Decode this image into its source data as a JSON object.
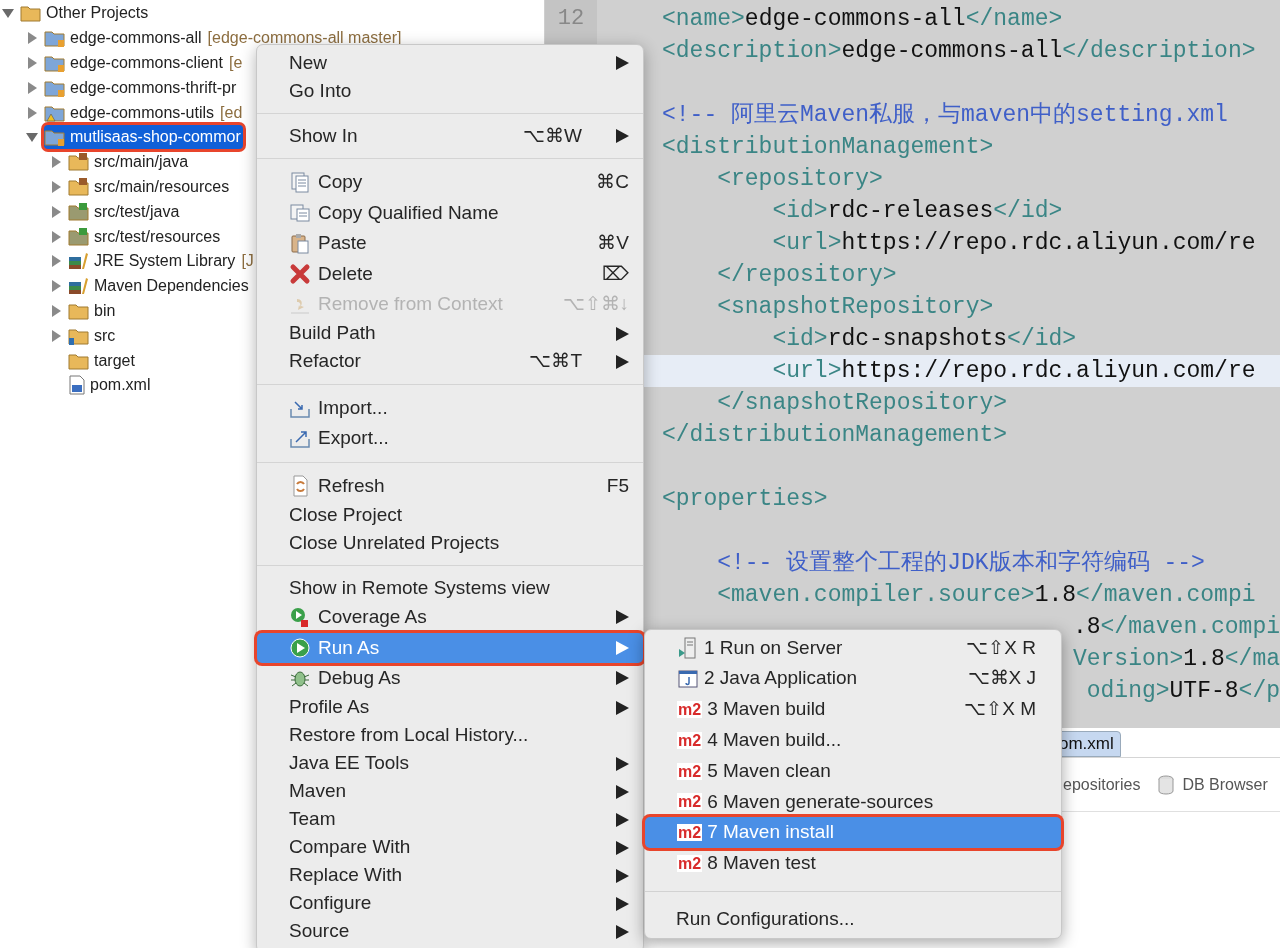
{
  "project_tree": {
    "items": [
      {
        "label": "Other Projects",
        "kind": "working-set",
        "expandable": true,
        "expanded": true,
        "selected": false,
        "children": [
          {
            "label": "edge-commons-all",
            "decoration": "[edge-commons-all master]",
            "kind": "project",
            "expandable": true,
            "expanded": false,
            "selected": false
          },
          {
            "label": "edge-commons-client",
            "decoration": "[e",
            "kind": "project",
            "expandable": true,
            "expanded": false,
            "selected": false
          },
          {
            "label": "edge-commons-thrift-pr",
            "kind": "project",
            "expandable": true,
            "expanded": false,
            "selected": false
          },
          {
            "label": "edge-commons-utils",
            "decoration": "[ed",
            "kind": "project-warning",
            "expandable": true,
            "expanded": false,
            "selected": false
          },
          {
            "label": "mutlisaas-shop-commor",
            "kind": "project",
            "expandable": true,
            "expanded": true,
            "selected": true,
            "children": [
              {
                "label": "src/main/java",
                "kind": "source-folder",
                "expandable": true,
                "expanded": false,
                "selected": false
              },
              {
                "label": "src/main/resources",
                "kind": "source-folder",
                "expandable": true,
                "expanded": false,
                "selected": false
              },
              {
                "label": "src/test/java",
                "kind": "test-folder",
                "expandable": true,
                "expanded": false,
                "selected": false
              },
              {
                "label": "src/test/resources",
                "kind": "test-folder",
                "expandable": true,
                "expanded": false,
                "selected": false
              },
              {
                "label": "JRE System Library",
                "decoration": "[J",
                "kind": "library",
                "expandable": true,
                "expanded": false,
                "selected": false
              },
              {
                "label": "Maven Dependencies",
                "kind": "library",
                "expandable": true,
                "expanded": false,
                "selected": false
              },
              {
                "label": "bin",
                "kind": "folder",
                "expandable": true,
                "expanded": false,
                "selected": false
              },
              {
                "label": "src",
                "kind": "package-folder",
                "expandable": true,
                "expanded": false,
                "selected": false
              },
              {
                "label": "target",
                "kind": "folder",
                "expandable": false,
                "selected": false
              },
              {
                "label": "pom.xml",
                "kind": "file",
                "expandable": false,
                "selected": false
              }
            ]
          }
        ]
      }
    ]
  },
  "editor": {
    "line_number": "12",
    "lines": [
      {
        "kind": "code",
        "current": false,
        "segments": [
          {
            "kind": "tag",
            "text": "<name>"
          },
          {
            "kind": "text",
            "text": "edge-commons-all"
          },
          {
            "kind": "tag",
            "text": "</name>"
          }
        ]
      },
      {
        "kind": "code",
        "current": false,
        "segments": [
          {
            "kind": "tag",
            "text": "<description>"
          },
          {
            "kind": "text",
            "text": "edge-commons-all"
          },
          {
            "kind": "tag",
            "text": "</description>"
          }
        ]
      },
      {
        "kind": "blank",
        "current": false
      },
      {
        "kind": "code",
        "current": false,
        "segments": [
          {
            "kind": "comment",
            "text": "<!-- 阿里云Maven私服，与maven中的setting.xml"
          }
        ]
      },
      {
        "kind": "code",
        "current": false,
        "segments": [
          {
            "kind": "tag",
            "text": "<distributionManagement>"
          }
        ]
      },
      {
        "kind": "code",
        "current": false,
        "segments": [
          {
            "kind": "tag",
            "text": "    <repository>"
          }
        ]
      },
      {
        "kind": "code",
        "current": false,
        "segments": [
          {
            "kind": "tag",
            "text": "        <id>"
          },
          {
            "kind": "text",
            "text": "rdc-releases"
          },
          {
            "kind": "tag",
            "text": "</id>"
          }
        ]
      },
      {
        "kind": "code",
        "current": false,
        "segments": [
          {
            "kind": "tag",
            "text": "        <url>"
          },
          {
            "kind": "text",
            "text": "https://repo.rdc.aliyun.com/re"
          }
        ]
      },
      {
        "kind": "code",
        "current": false,
        "segments": [
          {
            "kind": "tag",
            "text": "    </repository>"
          }
        ]
      },
      {
        "kind": "code",
        "current": false,
        "segments": [
          {
            "kind": "tag",
            "text": "    <snapshotRepository>"
          }
        ]
      },
      {
        "kind": "code",
        "current": false,
        "segments": [
          {
            "kind": "tag",
            "text": "        <id>"
          },
          {
            "kind": "text",
            "text": "rdc-snapshots"
          },
          {
            "kind": "tag",
            "text": "</id>"
          }
        ]
      },
      {
        "kind": "code",
        "current": true,
        "segments": [
          {
            "kind": "tag",
            "text": "        <url>"
          },
          {
            "kind": "text",
            "text": "https://repo.rdc.aliyun.com/re"
          }
        ]
      },
      {
        "kind": "code",
        "current": false,
        "segments": [
          {
            "kind": "tag",
            "text": "    </snapshotRepository>"
          }
        ]
      },
      {
        "kind": "code",
        "current": false,
        "segments": [
          {
            "kind": "tag",
            "text": "</distributionManagement>"
          }
        ]
      },
      {
        "kind": "blank",
        "current": false
      },
      {
        "kind": "code",
        "current": false,
        "segments": [
          {
            "kind": "tag",
            "text": "<properties>"
          }
        ]
      },
      {
        "kind": "blank",
        "current": false
      },
      {
        "kind": "code",
        "current": false,
        "segments": [
          {
            "kind": "comment",
            "text": "    <!-- 设置整个工程的JDK版本和字符编码 -->"
          }
        ]
      },
      {
        "kind": "code",
        "current": false,
        "segments": [
          {
            "kind": "tag",
            "text": "    <maven.compiler.source>"
          },
          {
            "kind": "text",
            "text": "1.8"
          },
          {
            "kind": "tag",
            "text": "</maven.compi"
          }
        ]
      },
      {
        "kind": "partial",
        "current": false,
        "segments": [
          {
            "kind": "text",
            "text": ".8"
          },
          {
            "kind": "tag",
            "text": "</maven.compi"
          }
        ]
      },
      {
        "kind": "partial",
        "current": false,
        "segments": [
          {
            "kind": "tag",
            "text": "Version>"
          },
          {
            "kind": "text",
            "text": "1.8"
          },
          {
            "kind": "tag",
            "text": "</ma"
          }
        ]
      },
      {
        "kind": "partial",
        "current": false,
        "segments": [
          {
            "kind": "tag",
            "text": "oding>"
          },
          {
            "kind": "text",
            "text": "UTF-8"
          },
          {
            "kind": "tag",
            "text": "</p"
          }
        ]
      }
    ]
  },
  "editor_tabs": [
    {
      "label": "om.xml",
      "selected": true
    }
  ],
  "bottom_views": [
    {
      "label": "epositories",
      "kind": "plain"
    },
    {
      "label": "DB Browser",
      "kind": "database"
    }
  ],
  "context_menu": {
    "groups": [
      [
        {
          "label": "New",
          "kind": "plain",
          "submenu": true,
          "disabled": false,
          "selected": false
        },
        {
          "label": "Go Into",
          "kind": "plain",
          "submenu": false,
          "disabled": false,
          "selected": false
        }
      ],
      [
        {
          "label": "Show In",
          "shortcut": "⌥⌘W",
          "kind": "plain",
          "submenu": true,
          "disabled": false,
          "selected": false
        }
      ],
      [
        {
          "label": "Copy",
          "shortcut": "⌘C",
          "kind": "copy",
          "submenu": false,
          "disabled": false,
          "selected": false
        },
        {
          "label": "Copy Qualified Name",
          "kind": "copy-qualified",
          "submenu": false,
          "disabled": false,
          "selected": false
        },
        {
          "label": "Paste",
          "shortcut": "⌘V",
          "kind": "paste",
          "submenu": false,
          "disabled": false,
          "selected": false
        },
        {
          "label": "Delete",
          "shortcut": "⌦",
          "kind": "delete",
          "submenu": false,
          "disabled": false,
          "selected": false
        },
        {
          "label": "Remove from Context",
          "shortcut": "⌥⇧⌘↓",
          "kind": "remove",
          "submenu": false,
          "disabled": true,
          "selected": false
        },
        {
          "label": "Build Path",
          "kind": "plain",
          "submenu": true,
          "disabled": false,
          "selected": false
        },
        {
          "label": "Refactor",
          "shortcut": "⌥⌘T",
          "kind": "plain",
          "submenu": true,
          "disabled": false,
          "selected": false
        }
      ],
      [
        {
          "label": "Import...",
          "kind": "import",
          "submenu": false,
          "disabled": false,
          "selected": false
        },
        {
          "label": "Export...",
          "kind": "export",
          "submenu": false,
          "disabled": false,
          "selected": false
        }
      ],
      [
        {
          "label": "Refresh",
          "shortcut": "F5",
          "kind": "refresh",
          "submenu": false,
          "disabled": false,
          "selected": false
        },
        {
          "label": "Close Project",
          "kind": "plain",
          "submenu": false,
          "disabled": false,
          "selected": false
        },
        {
          "label": "Close Unrelated Projects",
          "kind": "plain",
          "submenu": false,
          "disabled": false,
          "selected": false
        }
      ],
      [
        {
          "label": "Show in Remote Systems view",
          "kind": "plain",
          "submenu": false,
          "disabled": false,
          "selected": false
        },
        {
          "label": "Coverage As",
          "kind": "coverage",
          "submenu": true,
          "disabled": false,
          "selected": false
        },
        {
          "label": "Run As",
          "kind": "run",
          "submenu": true,
          "disabled": false,
          "selected": true,
          "children": {
            "groups": [
              [
                {
                  "label": "1 Run on Server",
                  "shortcut": "⌥⇧X R",
                  "kind": "server",
                  "selected": false
                },
                {
                  "label": "2 Java Application",
                  "shortcut": "⌥⌘X J",
                  "kind": "java",
                  "selected": false
                },
                {
                  "label": "3 Maven build",
                  "shortcut": "⌥⇧X M",
                  "kind": "maven",
                  "badge": "m2",
                  "selected": false
                },
                {
                  "label": "4 Maven build...",
                  "kind": "maven",
                  "badge": "m2",
                  "selected": false
                },
                {
                  "label": "5 Maven clean",
                  "kind": "maven",
                  "badge": "m2",
                  "selected": false
                },
                {
                  "label": "6 Maven generate-sources",
                  "kind": "maven",
                  "badge": "m2",
                  "selected": false
                },
                {
                  "label": "7 Maven install",
                  "kind": "maven",
                  "badge": "m2",
                  "selected": true
                },
                {
                  "label": "8 Maven test",
                  "kind": "maven",
                  "badge": "m2",
                  "selected": false
                }
              ],
              [
                {
                  "label": "Run Configurations...",
                  "kind": "plain",
                  "selected": false
                }
              ]
            ]
          }
        },
        {
          "label": "Debug As",
          "kind": "debug",
          "submenu": true,
          "disabled": false,
          "selected": false
        },
        {
          "label": "Profile As",
          "kind": "plain",
          "submenu": true,
          "disabled": false,
          "selected": false
        },
        {
          "label": "Restore from Local History...",
          "kind": "plain",
          "submenu": false,
          "disabled": false,
          "selected": false
        },
        {
          "label": "Java EE Tools",
          "kind": "plain",
          "submenu": true,
          "disabled": false,
          "selected": false
        },
        {
          "label": "Maven",
          "kind": "plain",
          "submenu": true,
          "disabled": false,
          "selected": false
        },
        {
          "label": "Team",
          "kind": "plain",
          "submenu": true,
          "disabled": false,
          "selected": false
        },
        {
          "label": "Compare With",
          "kind": "plain",
          "submenu": true,
          "disabled": false,
          "selected": false
        },
        {
          "label": "Replace With",
          "kind": "plain",
          "submenu": true,
          "disabled": false,
          "selected": false
        },
        {
          "label": "Configure",
          "kind": "plain",
          "submenu": true,
          "disabled": false,
          "selected": false
        },
        {
          "label": "Source",
          "kind": "plain",
          "submenu": true,
          "disabled": false,
          "selected": false
        }
      ]
    ]
  }
}
